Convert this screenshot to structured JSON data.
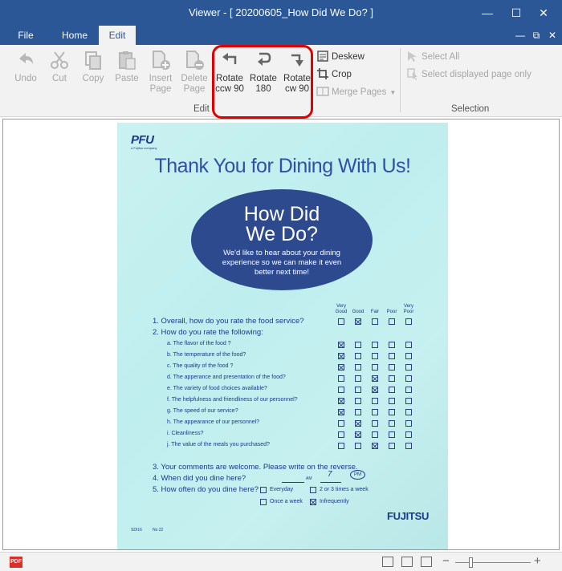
{
  "window": {
    "title": "Viewer - [ 20200605_How Did We Do? ]",
    "min_icon": "minimize-icon",
    "max_icon": "maximize-icon",
    "close_icon": "close-icon"
  },
  "tabs": [
    {
      "label": "File"
    },
    {
      "label": "Home"
    },
    {
      "label": "Edit",
      "active": true
    }
  ],
  "ribbon": {
    "edit_group": {
      "label": "Edit",
      "buttons": [
        {
          "label": "Undo",
          "icon": "undo-icon",
          "enabled": false
        },
        {
          "label": "Cut",
          "icon": "scissors-icon",
          "enabled": false
        },
        {
          "label": "Copy",
          "icon": "copy-icon",
          "enabled": false
        },
        {
          "label": "Paste",
          "icon": "paste-icon",
          "enabled": false
        },
        {
          "label": "Insert Page",
          "icon": "insert-page-icon",
          "enabled": false
        },
        {
          "label": "Delete Page",
          "icon": "delete-page-icon",
          "enabled": false
        },
        {
          "label": "Rotate ccw 90",
          "line1": "Rotate",
          "line2": "ccw 90",
          "icon": "rotate-ccw-icon",
          "enabled": true
        },
        {
          "label": "Rotate 180",
          "line1": "Rotate",
          "line2": "180",
          "icon": "rotate-180-icon",
          "enabled": true
        },
        {
          "label": "Rotate cw 90",
          "line1": "Rotate",
          "line2": "cw 90",
          "icon": "rotate-cw-icon",
          "enabled": true
        }
      ],
      "deskew": "Deskew",
      "crop": "Crop",
      "merge_pages": "Merge Pages"
    },
    "selection_group": {
      "label": "Selection",
      "select_all": "Select All",
      "select_displayed": "Select displayed page only"
    }
  },
  "document": {
    "logo": "PFU",
    "logo_sub": "a Fujitsu company",
    "headline": "Thank You for Dining With Us!",
    "ellipse_title_1": "How Did",
    "ellipse_title_2": "We Do?",
    "ellipse_sub_1": "We'd like to hear about your dining",
    "ellipse_sub_2": "experience so we can make it even",
    "ellipse_sub_3": "better next time!",
    "columns": [
      "Very Good",
      "Good",
      "Fair",
      "Poor",
      "Very Poor"
    ],
    "q1": "1.  Overall, how do you rate the food service?",
    "q1_answer": 1,
    "q2": "2. How do you rate the following:",
    "items": [
      {
        "text": "a.  The flavor of the food ?",
        "answer": 0
      },
      {
        "text": "b. The temperature of the food?",
        "answer": 0
      },
      {
        "text": "c. The quality of the food ?",
        "answer": 0
      },
      {
        "text": "d. The apperance and presentation of the food?",
        "answer": 2
      },
      {
        "text": "e. The variety of food choices available?",
        "answer": 2
      },
      {
        "text": "f.  The helpfulness and friendliness of our personnel?",
        "answer": 0
      },
      {
        "text": "g. The speed of our service?",
        "answer": 0
      },
      {
        "text": "h. The appearance of our personnel?",
        "answer": 1
      },
      {
        "text": "i.   Cleanliness?",
        "answer": 1
      },
      {
        "text": "j.  The value of the meals you purchased?",
        "answer": 2
      }
    ],
    "q3": "3. Your comments are welcome. Please  write on the reverse.",
    "q4": "4. When did you dine here?",
    "q4_am": "AM",
    "q4_handwritten": "7",
    "q4_pm": "PM",
    "q5": "5. How often do you dine here?",
    "q5_options": [
      "Everyday",
      "2 or 3 times a week",
      "Once a week",
      "Infrequently"
    ],
    "q5_checked": "Infrequently",
    "brand": "FUJITSU",
    "form_code": "SDI16",
    "form_no": "No 22"
  },
  "status": {
    "pdf_label": "PDF",
    "zoom_minus": "−",
    "zoom_plus": "+",
    "zoom_level": 0.2
  }
}
